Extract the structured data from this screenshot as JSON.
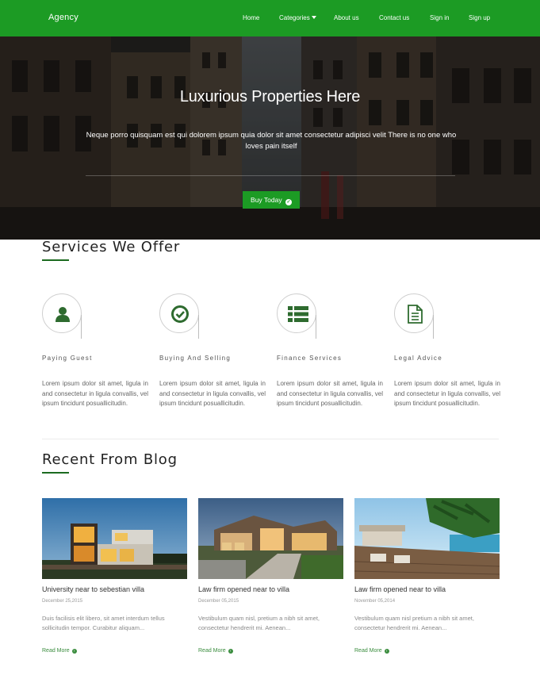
{
  "nav": {
    "brand": "Agency",
    "items": [
      {
        "label": "Home"
      },
      {
        "label": "Categories",
        "has_dropdown": true
      },
      {
        "label": "About us"
      },
      {
        "label": "Contact us"
      },
      {
        "label": "Sign in"
      },
      {
        "label": "Sign up"
      }
    ]
  },
  "hero": {
    "title": "Luxurious Properties Here",
    "subtitle": "Neque porro quisquam est qui dolorem ipsum quia dolor sit amet consectetur adipisci velit There is no one who loves pain itself",
    "button_label": "Buy Today",
    "button_icon": "check-circle-icon"
  },
  "services": {
    "title": "Services We Offer",
    "items": [
      {
        "name": "Paying Guest",
        "icon": "user-icon",
        "text": "Lorem ipsum dolor sit amet, ligula in and consectetur in ligula convallis, vel ipsum tincidunt posuallicitudin."
      },
      {
        "name": "Buying And Selling",
        "icon": "check-circle-icon",
        "text": "Lorem ipsum dolor sit amet, ligula in and consectetur in ligula convallis, vel ipsum tincidunt posuallicitudin."
      },
      {
        "name": "Finance Services",
        "icon": "list-icon",
        "text": "Lorem ipsum dolor sit amet, ligula in and consectetur in ligula convallis, vel ipsum tincidunt posuallicitudin."
      },
      {
        "name": "Legal Advice",
        "icon": "document-icon",
        "text": "Lorem ipsum dolor sit amet, ligula in and consectetur in ligula convallis, vel ipsum tincidunt posuallicitudin."
      }
    ]
  },
  "blog": {
    "title": "Recent From Blog",
    "posts": [
      {
        "title": "University near to sebestian villa",
        "date": "December 25,2015",
        "excerpt": "Duis facilisis elit libero, sit amet interdum tellus sollicitudin tempor. Curabitur aliquam...",
        "read_more": "Read More"
      },
      {
        "title": "Law firm opened near to villa",
        "date": "December 05,2015",
        "excerpt": "Vestibulum quam nisl, pretium a nibh sit amet, consectetur hendrerit mi. Aenean...",
        "read_more": "Read More"
      },
      {
        "title": "Law firm opened near to villa",
        "date": "November 05,2014",
        "excerpt": "Vestibulum quam nisl pretium a nibh sit amet, consectetur hendrerit mi. Aenean...",
        "read_more": "Read More"
      }
    ]
  },
  "colors": {
    "brand_green": "#1c9b24",
    "accent_dark_green": "#1c6b20"
  }
}
